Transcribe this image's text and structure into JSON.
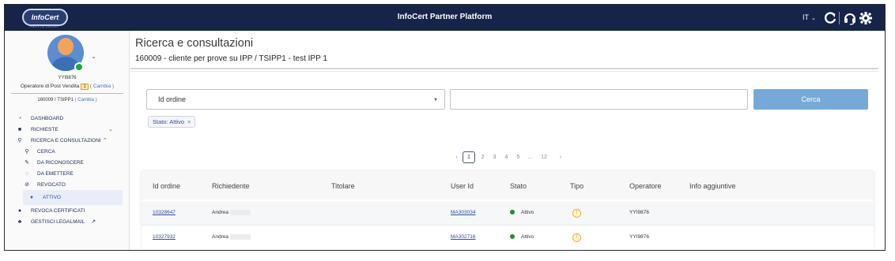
{
  "header": {
    "logo_text": "InfoCert",
    "logo_sub": "TINEXTA GROUP",
    "title": "InfoCert Partner Platform",
    "language": "IT",
    "icons": [
      "refresh-icon",
      "headset-icon",
      "gear-icon"
    ]
  },
  "user": {
    "id": "YYI9876",
    "role_prefix": "Operatore di Post Vendita",
    "role_count": "1",
    "role_change": "( Cambia )",
    "context": "160009 / TSIPP1",
    "context_change": "( Cambia )"
  },
  "nav": {
    "dashboard": "DASHBOARD",
    "richieste": "RICHIESTE",
    "ricerca": "RICERCA E CONSULTAZIONI",
    "cerca": "CERCA",
    "da_riconoscere": "DA RICONOSCERE",
    "da_emettere": "DA EMETTERE",
    "revocato": "REVOCATO",
    "attivo": "ATTIVO",
    "revoca_certificati": "REVOCA CERTIFICATI",
    "gestisci_legalmail": "GESTISCI LEGALMAIL"
  },
  "main": {
    "title": "Ricerca e consultazioni",
    "subtitle": "160009 - cliente per prove su IPP  / TSIPP1 - test IPP 1",
    "search": {
      "field_select": "Id ordine",
      "value": "",
      "button": "Cerca"
    },
    "filter_chip": "Stato: Attivo",
    "filter_chip_remove": "×",
    "pagination": {
      "prev": "‹",
      "current": "1",
      "pages": [
        "2",
        "3",
        "4",
        "5",
        "...",
        "12"
      ],
      "next": "›"
    },
    "table": {
      "columns": [
        "Id ordine",
        "Richiedente",
        "Titolare",
        "User Id",
        "Stato",
        "Tipo",
        "Operatore",
        "Info aggiuntive"
      ],
      "rows": [
        {
          "id_ordine": "10328647",
          "richiedente": "Andrea",
          "titolare": "",
          "user_id": "MA303034",
          "stato": "Attivo",
          "tipo": "!",
          "operatore": "YYI9876",
          "info": ""
        },
        {
          "id_ordine": "10327932",
          "richiedente": "Andrea",
          "titolare": "",
          "user_id": "MA302716",
          "stato": "Attivo",
          "tipo": "!",
          "operatore": "YYI9876",
          "info": ""
        }
      ]
    }
  },
  "colors": {
    "topbar": "#16244a",
    "button": "#77a9d8",
    "status_active": "#1f8e2e",
    "link": "#2d4b9b"
  }
}
